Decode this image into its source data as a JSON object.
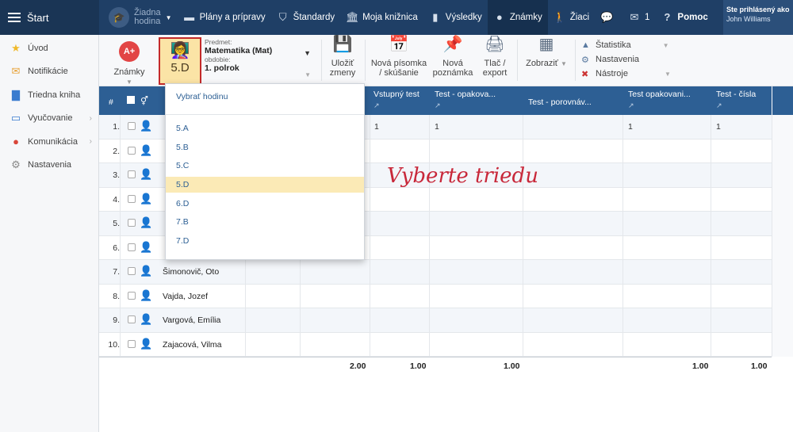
{
  "nav": {
    "start": "Štart",
    "hodina": "Žiadna\nhodina",
    "items": [
      {
        "label": "Plány a prípravy",
        "icon": "briefcase-icon"
      },
      {
        "label": "Štandardy",
        "icon": "shield-icon"
      },
      {
        "label": "Moja knižnica",
        "icon": "library-icon"
      },
      {
        "label": "Výsledky",
        "icon": "bar-chart-icon"
      },
      {
        "label": "Známky",
        "icon": "grade-icon"
      },
      {
        "label": "Žiaci",
        "icon": "students-icon"
      }
    ],
    "messages_count": "1",
    "help": "Pomoc",
    "user_label": "Ste prihlásený ako",
    "user_name": "John Williams"
  },
  "sidebar": {
    "items": [
      {
        "label": "Úvod",
        "icon": "star-icon"
      },
      {
        "label": "Notifikácie",
        "icon": "envelope-icon"
      },
      {
        "label": "Triedna kniha",
        "icon": "book-icon"
      },
      {
        "label": "Vyučovanie",
        "icon": "open-book-icon"
      },
      {
        "label": "Komunikácia",
        "icon": "chat-icon"
      },
      {
        "label": "Nastavenia",
        "icon": "gear-icon"
      }
    ]
  },
  "toolbar": {
    "znamky": "Známky",
    "znamky_badge": "A+",
    "trieda": "5.D",
    "predmet_label": "Predmet:",
    "predmet_value": "Matematika (Mat)",
    "obdobie_label": "obdobie:",
    "obdobie_value": "1. polrok",
    "ulozit": "Uložiť\nzmeny",
    "nova_pisomka": "Nová písomka\n/ skúšanie",
    "nova_poznamka": "Nová\npoznámka",
    "tlac": "Tlač /\nexport",
    "zobrazit": "Zobraziť",
    "statistika": "Štatistika",
    "nastavenia": "Nastavenia",
    "nastroje": "Nástroje"
  },
  "grid": {
    "col_num": "#",
    "columns": [
      {
        "title": "Vstupný test"
      },
      {
        "title": "Test - opakova..."
      },
      {
        "title": "Test - porovnáv..."
      },
      {
        "title": "Test opakovani..."
      },
      {
        "title": "Test - čísla"
      }
    ],
    "rows": [
      {
        "n": "1.",
        "name": "",
        "vals": [
          "1",
          "1",
          "",
          "1",
          "1"
        ]
      },
      {
        "n": "2.",
        "name": "",
        "vals": [
          "",
          "",
          "",
          "",
          ""
        ]
      },
      {
        "n": "3.",
        "name": "",
        "vals": [
          "",
          "",
          "",
          "",
          ""
        ]
      },
      {
        "n": "4.",
        "name": "",
        "vals": [
          "",
          "",
          "",
          "",
          ""
        ]
      },
      {
        "n": "5.",
        "name": "",
        "vals": [
          "",
          "",
          "",
          "",
          ""
        ]
      },
      {
        "n": "6.",
        "name": "",
        "vals": [
          "",
          "",
          "",
          "",
          ""
        ]
      },
      {
        "n": "7.",
        "name": "Šimonovič, Oto",
        "vals": [
          "",
          "",
          "",
          "",
          ""
        ]
      },
      {
        "n": "8.",
        "name": "Vajda, Jozef",
        "vals": [
          "",
          "",
          "",
          "",
          ""
        ]
      },
      {
        "n": "9.",
        "name": "Vargová, Emília",
        "vals": [
          "",
          "",
          "",
          "",
          ""
        ]
      },
      {
        "n": "10.",
        "name": "Zajacová, Vilma",
        "vals": [
          "",
          "",
          "",
          "",
          ""
        ]
      }
    ],
    "totals": [
      "2.00",
      "1.00",
      "1.00",
      "1.00",
      "1.00"
    ]
  },
  "dropdown": {
    "title": "Vybrať hodinu",
    "options": [
      "5.A",
      "5.B",
      "5.C",
      "5.D",
      "6.D",
      "7.B",
      "7.D"
    ],
    "selected": "5.D"
  },
  "annotation": "Vyberte triedu"
}
